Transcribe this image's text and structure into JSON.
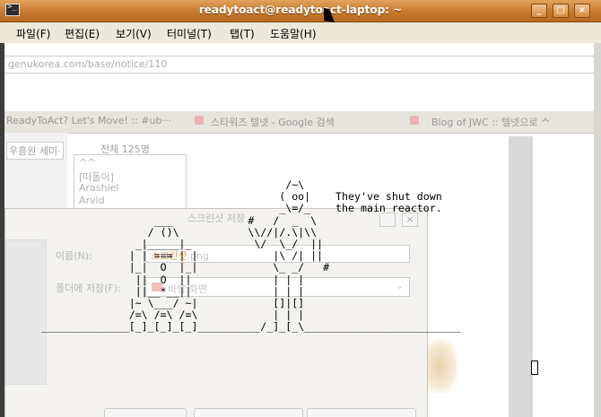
{
  "window": {
    "title": "readytoact@readytoact-laptop: ~"
  },
  "menu": [
    "파일(F)",
    "편집(E)",
    "보기(V)",
    "터미널(T)",
    "탭(T)",
    "도움말(H)"
  ],
  "browser": {
    "url": "genukorea.com/base/notice/110",
    "tabs": [
      "ReadyToAct? Let's Move! :: #ub···",
      "스타워즈 텔넷 - Google 검색",
      "Blog of JWC :: 텔넷으로 ᄉ"
    ],
    "left_text": "우흥원 세미·",
    "user_count": "전체 125명",
    "users": [
      "^^",
      "[떠돌이]",
      "Arashiel",
      "Arvid"
    ]
  },
  "dialog": {
    "title": "스크린샷 저장",
    "name_label": "이름(N):",
    "name_selected": "스크린샷",
    "name_ext": ".png",
    "folder_label": "폴더에 저장(F):",
    "folder_value": "바탕 화면"
  },
  "terminal": {
    "ascii": "                                       /~\\\n                                      ( oo|    They've shut down\n                                      _\\=/_    the main reactor.\n                  ___            #   /  _  \\\n                 / ()\\           \\\\//|/.\\|\\\\\n               _|_____|_          \\/  \\_/  ||\n              | | === | |            |\\ /| ||\n              |_|  O  |_|            \\_ _/   #\n               ||  O  ||             | | |\n               ||__*__||             | | |\n              |~ \\___/ ~|            []|[]\n              /=\\ /=\\ /=\\            | | |\n______________[_]_[_]_[_]__________/_]_[_\\_________________________"
  }
}
